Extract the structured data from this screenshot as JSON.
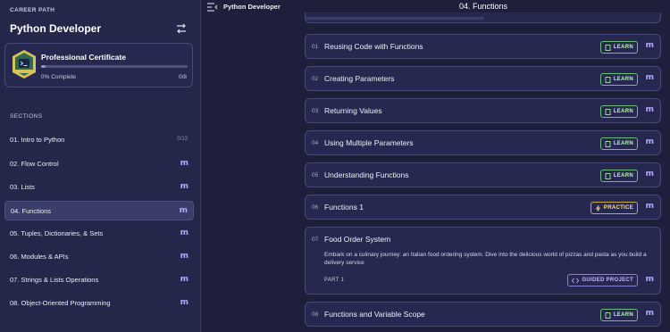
{
  "sidebar": {
    "eyebrow": "CAREER PATH",
    "title": "Python Developer",
    "certificate": {
      "title": "Professional Certificate",
      "progress_percent": 0,
      "complete_label": "0% Complete",
      "count": "0/8"
    },
    "sections_label": "SECTIONS",
    "sections": [
      {
        "label": "01. Intro to Python",
        "progress": "0/13"
      },
      {
        "label": "02. Flow Control"
      },
      {
        "label": "03. Lists"
      },
      {
        "label": "04. Functions",
        "active": true
      },
      {
        "label": "05. Tuples, Dictionaries, & Sets"
      },
      {
        "label": "06. Modules & APIs"
      },
      {
        "label": "07. Strings & Lists Operations"
      },
      {
        "label": "08. Object-Oriented Programming"
      }
    ]
  },
  "topbar": {
    "path_label": "Python Developer",
    "section_title": "04. Functions"
  },
  "lessons": [
    {
      "num": "01",
      "title": "Reusing Code with Functions",
      "tag": "LEARN"
    },
    {
      "num": "02",
      "title": "Creating Parameters",
      "tag": "LEARN"
    },
    {
      "num": "03",
      "title": "Returning Values",
      "tag": "LEARN"
    },
    {
      "num": "04",
      "title": "Using Multiple Parameters",
      "tag": "LEARN"
    },
    {
      "num": "05",
      "title": "Understanding Functions",
      "tag": "LEARN"
    },
    {
      "num": "06",
      "title": "Functions 1",
      "tag": "PRACTICE"
    },
    {
      "num": "07",
      "title": "Food Order System",
      "tag": "GUIDED PROJECT",
      "description": "Embark on a culinary journey: an Italian food ordering system. Dive into the delicious world of pizzas and pasta as you build a delivery service",
      "part": "PART 1"
    },
    {
      "num": "08",
      "title": "Functions and Variable Scope",
      "tag": "LEARN"
    }
  ],
  "colors": {
    "background": "#1e1f3a",
    "sidebar": "#24264a",
    "learn": "#b9f5b9",
    "practice": "#ffe08a",
    "guided": "#c7b9ff",
    "logo": "#b8a8ff"
  }
}
